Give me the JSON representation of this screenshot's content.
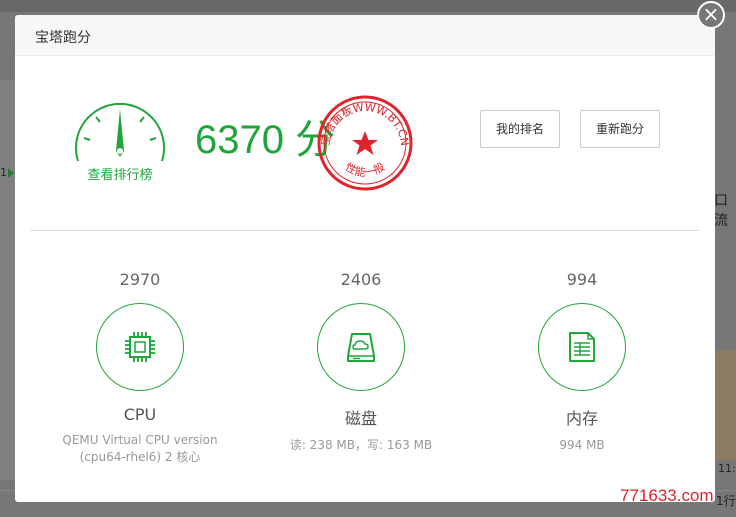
{
  "modal": {
    "title": "宝塔跑分",
    "close_symbol": "×"
  },
  "gauge": {
    "label": "查看排行榜"
  },
  "score": {
    "text": "6370 分"
  },
  "seal": {
    "top_text": "宝塔面板WWW.BT.CN",
    "bottom_text": "性能一般",
    "color": "#e0242b"
  },
  "buttons": {
    "rank_label": "我的排名",
    "retest_label": "重新跑分"
  },
  "metrics": [
    {
      "value": "2970",
      "name": "CPU",
      "desc": "QEMU Virtual CPU version (cpu64-rhel6) 2 核心"
    },
    {
      "value": "2406",
      "name": "磁盘",
      "desc": "读: 238 MB，写: 163 MB"
    },
    {
      "value": "994",
      "name": "内存",
      "desc": "994 MB"
    }
  ],
  "background": {
    "left_text": "1",
    "right_text": "口流",
    "time_text": "11:",
    "bottom_text": "1行"
  },
  "watermark": "771633.com",
  "colors": {
    "accent": "#20a53a",
    "seal": "#e0242b"
  }
}
